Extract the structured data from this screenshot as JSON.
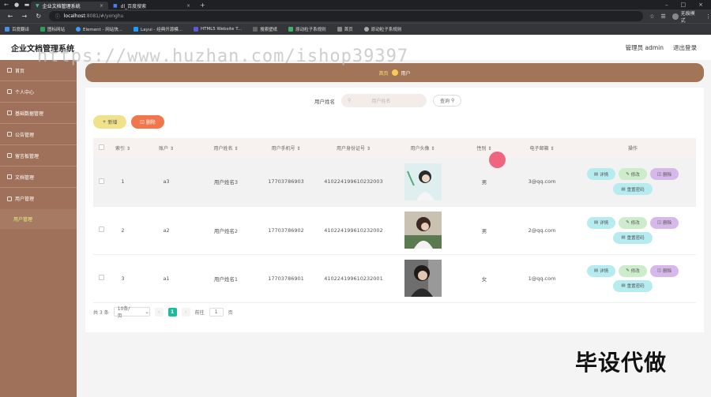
{
  "browser": {
    "tabs": [
      {
        "title": "企业文档管理系统"
      },
      {
        "title": "dl_百度搜索"
      }
    ],
    "url_host": "localhost",
    "url_path": ":8081/#/yonghu",
    "profile": "无痕模式",
    "bookmarks": [
      "百度翻译",
      "图标网站",
      "Element - 网站快...",
      "Layui - 经典开源模...",
      "HTML5 Website T...",
      "搜索壁纸",
      "原动粒子系规则",
      "首页",
      "原动粒子系规则"
    ]
  },
  "header": {
    "title": "企业文档管理系统",
    "admin": "管理员 admin",
    "logout": "退出登录"
  },
  "watermark": "https://www.huzhan.com/ishop39397",
  "sidebar": {
    "items": [
      {
        "label": "首页"
      },
      {
        "label": "个人中心"
      },
      {
        "label": "基础数据管理"
      },
      {
        "label": "公告管理"
      },
      {
        "label": "留言板管理"
      },
      {
        "label": "文档管理"
      },
      {
        "label": "用户管理"
      }
    ],
    "active_sub": "用户管理"
  },
  "breadcrumb": {
    "home": "首页",
    "current": "用户"
  },
  "search": {
    "label": "用户姓名",
    "placeholder": "用户姓名",
    "button": "查询"
  },
  "toolbar": {
    "add": "新增",
    "delete": "删除"
  },
  "table": {
    "headers": [
      "",
      "索引",
      "账户",
      "用户姓名",
      "用户手机号",
      "用户身份证号",
      "用户头像",
      "性别",
      "电子邮箱",
      "操作"
    ],
    "rows": [
      {
        "index": "1",
        "account": "a3",
        "name": "用户姓名3",
        "phone": "17703786903",
        "idcard": "410224199610232003",
        "gender": "男",
        "email": "3@qq.com"
      },
      {
        "index": "2",
        "account": "a2",
        "name": "用户姓名2",
        "phone": "17703786902",
        "idcard": "410224199610232002",
        "gender": "男",
        "email": "2@qq.com"
      },
      {
        "index": "3",
        "account": "a1",
        "name": "用户姓名1",
        "phone": "17703786901",
        "idcard": "410224199610232001",
        "gender": "女",
        "email": "1@qq.com"
      }
    ],
    "actions": {
      "detail": "详情",
      "edit": "修改",
      "delete": "删除",
      "reset": "重置密码"
    }
  },
  "pagination": {
    "total": "共 3 条",
    "page_size": "10条/页",
    "current": "1",
    "goto": "前往",
    "goto_value": "1",
    "page_unit": "页"
  },
  "promo": "毕设代做"
}
